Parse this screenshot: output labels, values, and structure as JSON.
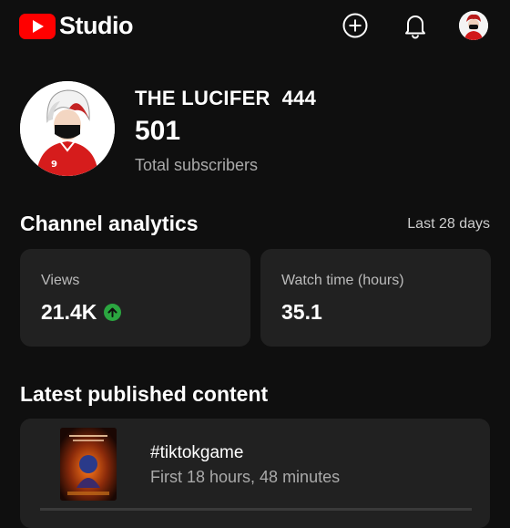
{
  "app": {
    "logo_text": "Studio"
  },
  "header": {
    "icons": [
      "create-icon",
      "notifications-icon",
      "account-avatar"
    ]
  },
  "channel": {
    "name": "THE LUCIFER  444",
    "subscriber_count": "501",
    "subscriber_label": "Total subscribers",
    "avatar_shirt_number": "9"
  },
  "analytics": {
    "title": "Channel analytics",
    "period": "Last 28 days",
    "cards": [
      {
        "label": "Views",
        "value": "21.4K",
        "trend": "up"
      },
      {
        "label": "Watch time (hours)",
        "value": "35.1"
      }
    ]
  },
  "latest": {
    "title": "Latest published content",
    "video": {
      "title": "#tiktokgame",
      "meta": "First 18 hours, 48 minutes"
    }
  },
  "colors": {
    "brand_red": "#ff0000",
    "background": "#0f0f0f",
    "card": "#212121",
    "trend_up": "#2ba640"
  }
}
